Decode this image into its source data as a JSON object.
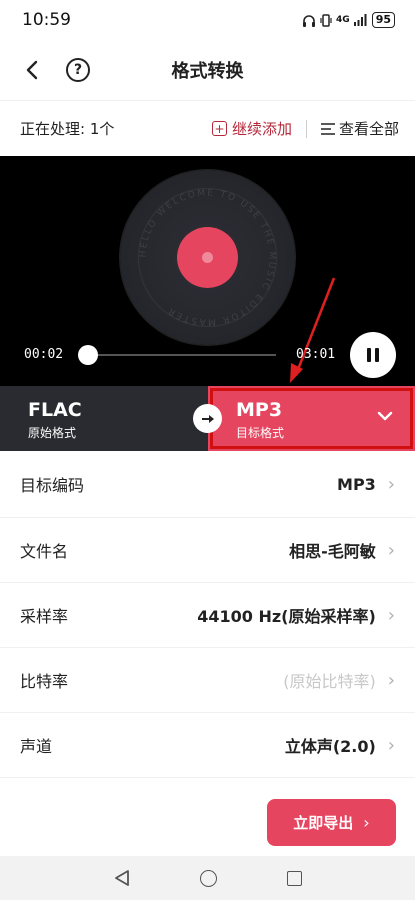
{
  "status_bar": {
    "time": "10:59",
    "network": "4G",
    "battery": "95"
  },
  "header": {
    "title": "格式转换",
    "back_icon": "chevron-left-icon",
    "help_icon": "question-circle-icon"
  },
  "processing": {
    "status_text": "正在处理: 1个",
    "add_more_label": "继续添加",
    "view_all_label": "查看全部"
  },
  "player": {
    "current_time": "00:02",
    "total_time": "03:01",
    "progress": 0.011,
    "record_text": "HELLO WELCOME TO USE THE MUSIC EDITOR MASTER",
    "state": "playing"
  },
  "formats": {
    "source_format": "FLAC",
    "source_label": "原始格式",
    "target_format": "MP3",
    "target_label": "目标格式"
  },
  "settings": [
    {
      "label": "目标编码",
      "value": "MP3",
      "placeholder": false
    },
    {
      "label": "文件名",
      "value": "相思-毛阿敏",
      "placeholder": false
    },
    {
      "label": "采样率",
      "value": "44100 Hz(原始采样率)",
      "placeholder": false
    },
    {
      "label": "比特率",
      "value": "(原始比特率)",
      "placeholder": true
    },
    {
      "label": "声道",
      "value": "立体声(2.0)",
      "placeholder": false
    }
  ],
  "export": {
    "label": "立即导出"
  },
  "colors": {
    "accent": "#e64560",
    "highlight_box": "#d01010",
    "source_bg": "#2a2b30"
  }
}
